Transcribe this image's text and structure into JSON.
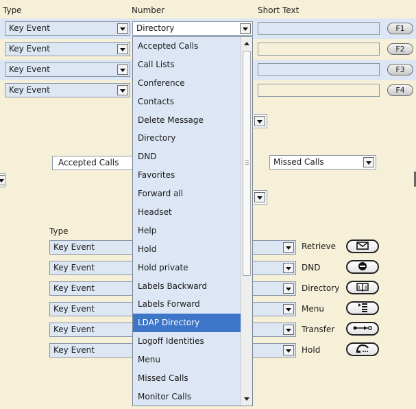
{
  "headers": {
    "type": "Type",
    "number": "Number",
    "short_text": "Short Text"
  },
  "rows": [
    {
      "type": "Key Event",
      "fkey": "F1"
    },
    {
      "type": "Key Event",
      "fkey": "F2"
    },
    {
      "type": "Key Event",
      "fkey": "F3"
    },
    {
      "type": "Key Event",
      "fkey": "F4"
    }
  ],
  "number_select": {
    "value": "Directory"
  },
  "dropdown": {
    "options": [
      "Accepted Calls",
      "Call Lists",
      "Conference",
      "Contacts",
      "Delete Message",
      "Directory",
      "DND",
      "Favorites",
      "Forward all",
      "Headset",
      "Help",
      "Hold",
      "Hold private",
      "Labels Backward",
      "Labels Forward",
      "LDAP Directory",
      "Logoff Identities",
      "Menu",
      "Missed Calls",
      "Monitor Calls"
    ],
    "highlighted": "LDAP Directory"
  },
  "middle": {
    "left_select": "Accepted Calls",
    "right_select": "Missed Calls"
  },
  "lower": {
    "type_header": "Type",
    "rows": [
      {
        "type": "Key Event",
        "label": "Retrieve",
        "icon": "envelope-icon"
      },
      {
        "type": "Key Event",
        "label": "DND",
        "icon": "do-not-disturb-icon"
      },
      {
        "type": "Key Event",
        "label": "Directory",
        "icon": "book-icon"
      },
      {
        "type": "Key Event",
        "label": "Menu",
        "icon": "menu-list-icon"
      },
      {
        "type": "Key Event",
        "label": "Transfer",
        "icon": "transfer-icon"
      },
      {
        "type": "Key Event",
        "label": "Hold",
        "icon": "handset-icon"
      }
    ]
  },
  "colors": {
    "highlight": "#3d75c8",
    "background": "#f6f0d8",
    "row_blue": "#dce6f4"
  }
}
